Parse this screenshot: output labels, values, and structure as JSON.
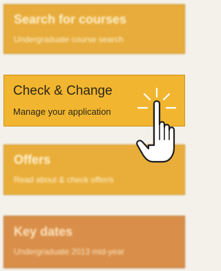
{
  "menu": {
    "tiles": [
      {
        "title": "Search for courses",
        "subtitle": "Undergraduate course search"
      },
      {
        "title": "Check & Change",
        "subtitle": "Manage your application"
      },
      {
        "title": "Offers",
        "subtitle": "Read about & check offer/s"
      },
      {
        "title": "Key dates",
        "subtitle": "Undergraduate 2013 mid-year"
      }
    ]
  },
  "cursor": {
    "icon": "hand-pointer-icon",
    "state": "clicking"
  },
  "colors": {
    "tile_yellow": "#f1b52f",
    "tile_orange": "#d98f49",
    "text_dark": "#2b2617",
    "text_light": "#fff3d2"
  }
}
